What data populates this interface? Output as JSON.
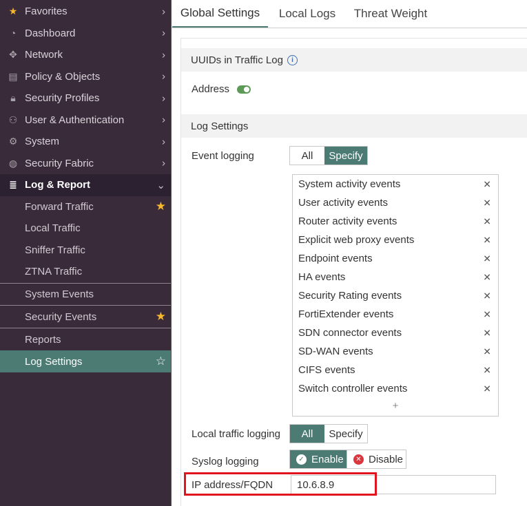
{
  "sidebar": {
    "items": [
      {
        "label": "Favorites",
        "icon": "star-icon"
      },
      {
        "label": "Dashboard",
        "icon": "dashboard-icon"
      },
      {
        "label": "Network",
        "icon": "network-icon"
      },
      {
        "label": "Policy & Objects",
        "icon": "policy-icon"
      },
      {
        "label": "Security Profiles",
        "icon": "lock-icon"
      },
      {
        "label": "User & Authentication",
        "icon": "user-icon"
      },
      {
        "label": "System",
        "icon": "gear-icon"
      },
      {
        "label": "Security Fabric",
        "icon": "fabric-icon"
      },
      {
        "label": "Log & Report",
        "icon": "log-icon"
      }
    ],
    "sub_items": [
      {
        "label": "Forward Traffic",
        "starred": true
      },
      {
        "label": "Local Traffic",
        "starred": false
      },
      {
        "label": "Sniffer Traffic",
        "starred": false
      },
      {
        "label": "ZTNA Traffic",
        "starred": false
      },
      {
        "label": "System Events",
        "starred": false
      },
      {
        "label": "Security Events",
        "starred": true
      },
      {
        "label": "Reports",
        "starred": false
      },
      {
        "label": "Log Settings",
        "starred": false
      }
    ]
  },
  "tabs": [
    {
      "label": "Global Settings"
    },
    {
      "label": "Local Logs"
    },
    {
      "label": "Threat Weight"
    }
  ],
  "uuids": {
    "header": "UUIDs in Traffic Log",
    "address_label": "Address",
    "address_enabled": true
  },
  "log_settings": {
    "header": "Log Settings",
    "event_logging_label": "Event logging",
    "event_logging_options": [
      "All",
      "Specify"
    ],
    "event_logging_selected": "Specify",
    "events": [
      "System activity events",
      "User activity events",
      "Router activity events",
      "Explicit web proxy events",
      "Endpoint events",
      "HA events",
      "Security Rating events",
      "FortiExtender events",
      "SDN connector events",
      "SD-WAN events",
      "CIFS events",
      "Switch controller events"
    ],
    "add_symbol": "+",
    "local_traffic_label": "Local traffic logging",
    "local_traffic_options": [
      "All",
      "Specify"
    ],
    "local_traffic_selected": "All",
    "syslog_label": "Syslog logging",
    "syslog_enable": "Enable",
    "syslog_disable": "Disable",
    "syslog_selected": "Enable",
    "ip_label": "IP address/FQDN",
    "ip_value": "10.6.8.9"
  },
  "colors": {
    "sidebar_bg": "#3a2b3a",
    "accent": "#4c7b74",
    "star": "#f5b82e",
    "toggle_on": "#5e9a57",
    "highlight": "#e0141e",
    "disable_icon": "#d9363e"
  }
}
